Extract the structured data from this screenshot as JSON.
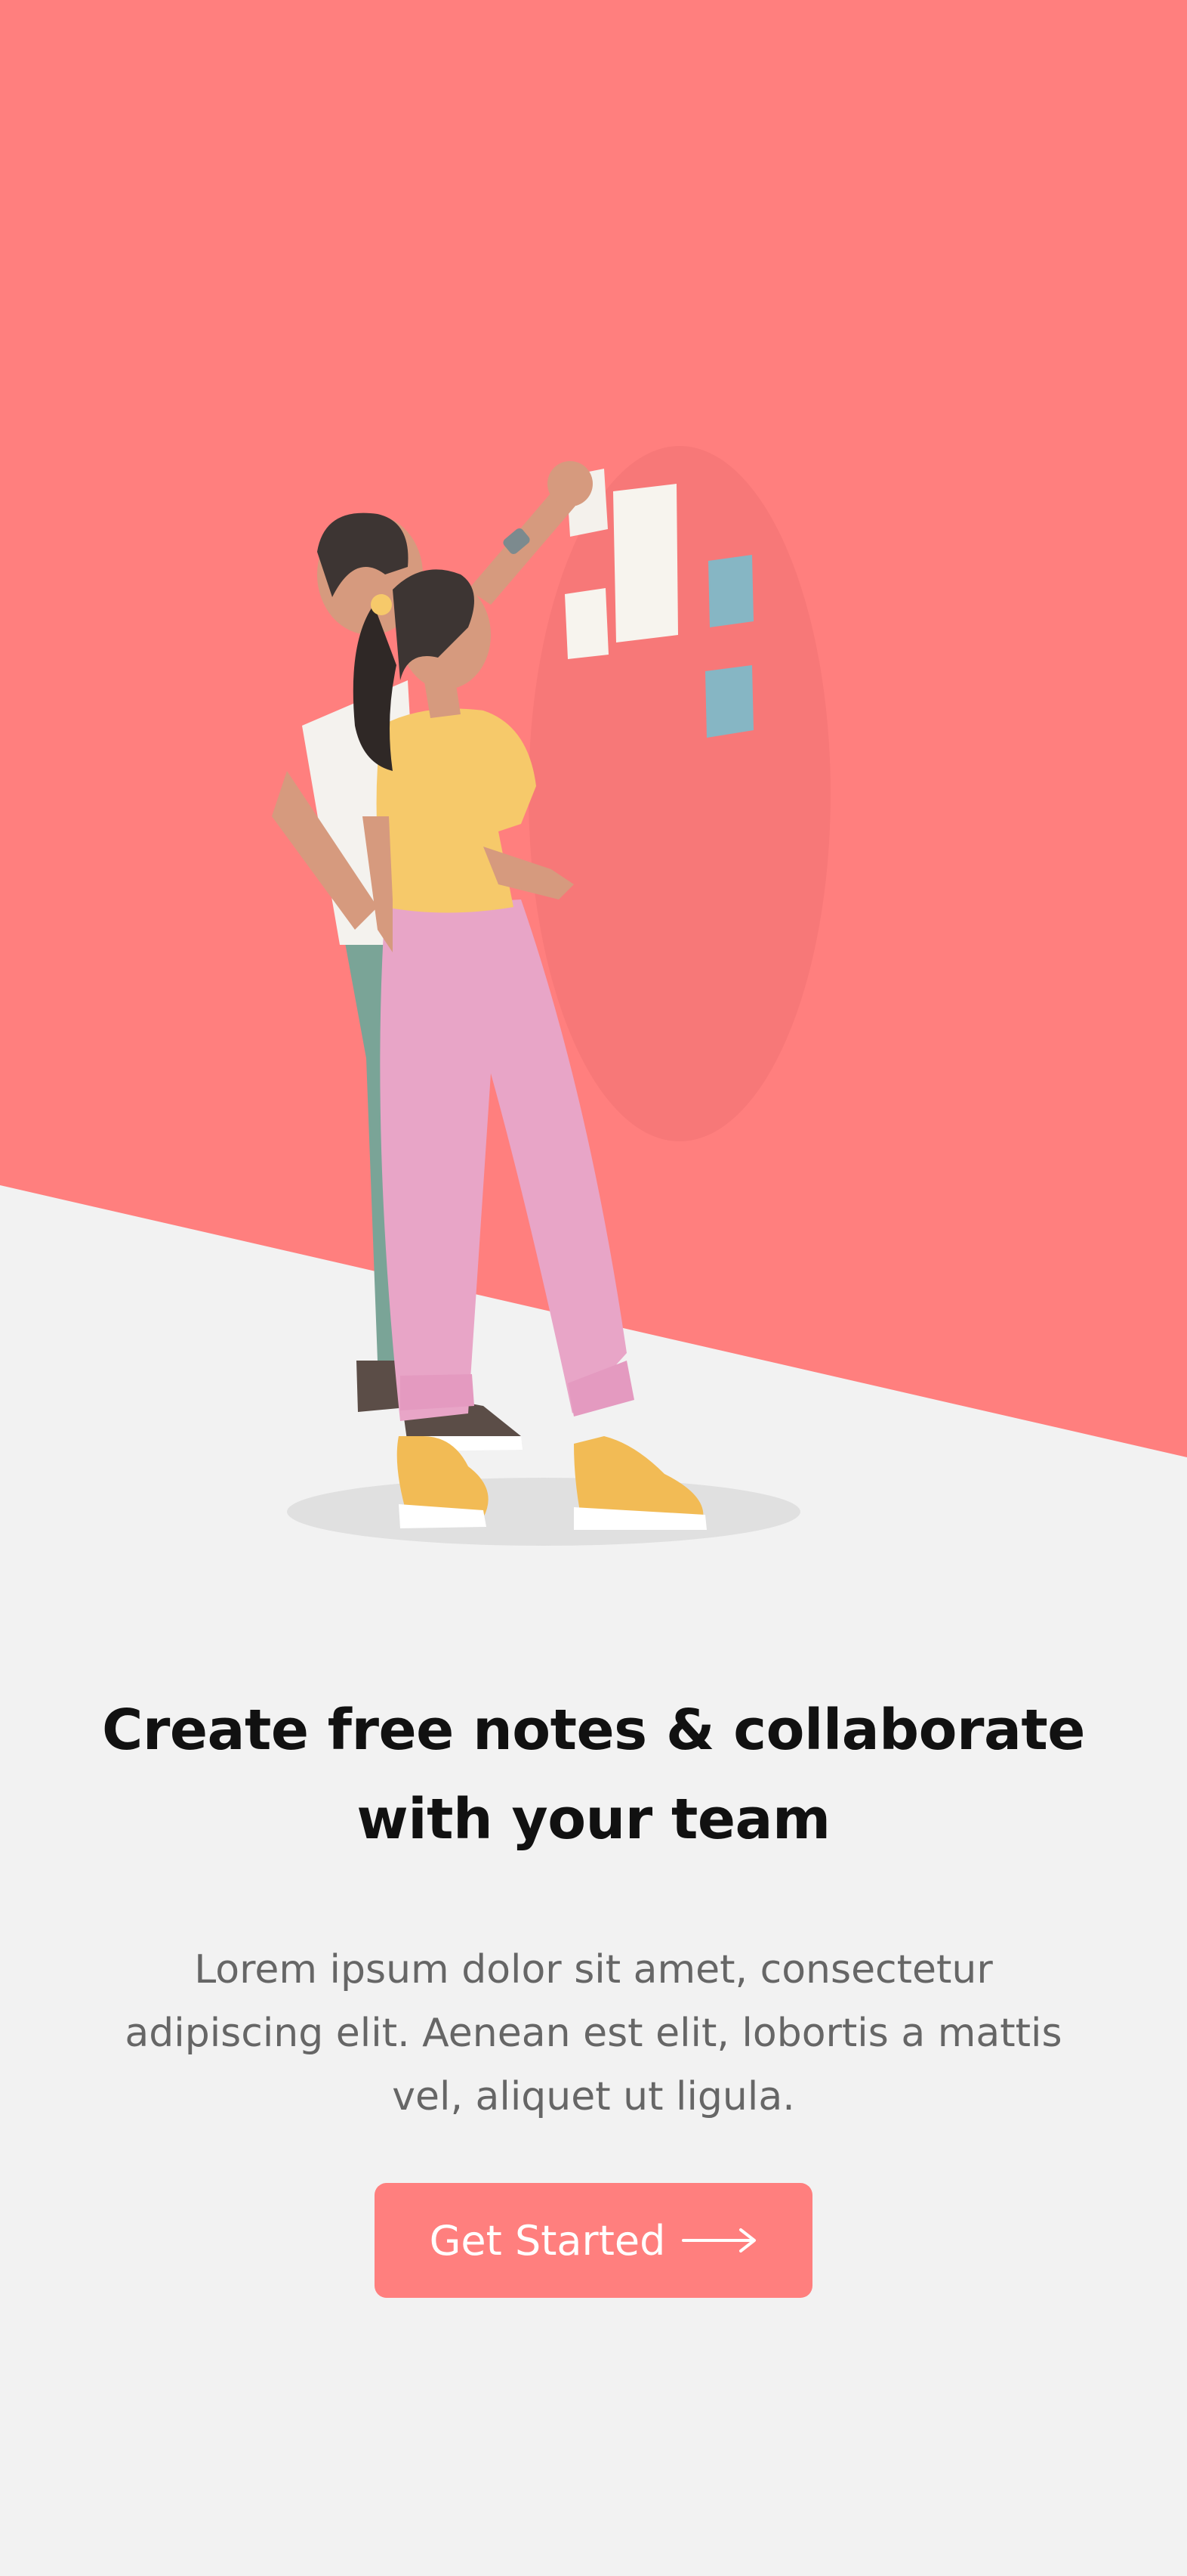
{
  "theme": {
    "accent": "#ff7f7e",
    "background": "#f2f2f2",
    "title_color": "#111111",
    "body_color": "#666666"
  },
  "onboarding": {
    "headline_lines": [
      "Create free notes & collaborate",
      "with your team"
    ],
    "description_lines": [
      "Lorem ipsum dolor sit amet, consectetur",
      "adipiscing elit. Aenean est elit, lobortis a mattis",
      "vel, aliquet ut ligula."
    ],
    "cta_label": "Get Started",
    "cta_icon": "arrow-right-icon",
    "illustration": "two-people-sticking-notes-on-wall"
  }
}
